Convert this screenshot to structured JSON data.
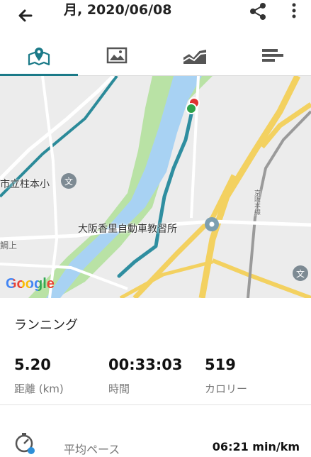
{
  "header": {
    "title": "月, 2020/06/08"
  },
  "tabs": [
    {
      "name": "map",
      "icon": "map-pin-icon",
      "active": true
    },
    {
      "name": "photos",
      "icon": "image-icon",
      "active": false
    },
    {
      "name": "chart",
      "icon": "area-chart-icon",
      "active": false
    },
    {
      "name": "details",
      "icon": "list-icon",
      "active": false
    }
  ],
  "map": {
    "labels": {
      "school": "市立柱本小",
      "driving_school": "大阪香里自動車教習所",
      "area": "鯛上",
      "road": "京阪本線"
    },
    "attribution": "Google",
    "colors": {
      "route": "#2f8ea0",
      "river": "#aad3f5",
      "park": "#b8e0a4",
      "highway": "#f5d56b",
      "accent": "#1b7a88"
    }
  },
  "activity": {
    "type": "ランニング",
    "distance_value": "5.20",
    "distance_label": "距離 (km)",
    "time_value": "00:33:03",
    "time_label": "時間",
    "calorie_value": "519",
    "calorie_label": "カロリー"
  },
  "pace": {
    "label": "平均ペース",
    "value": "06:21 min/km"
  }
}
